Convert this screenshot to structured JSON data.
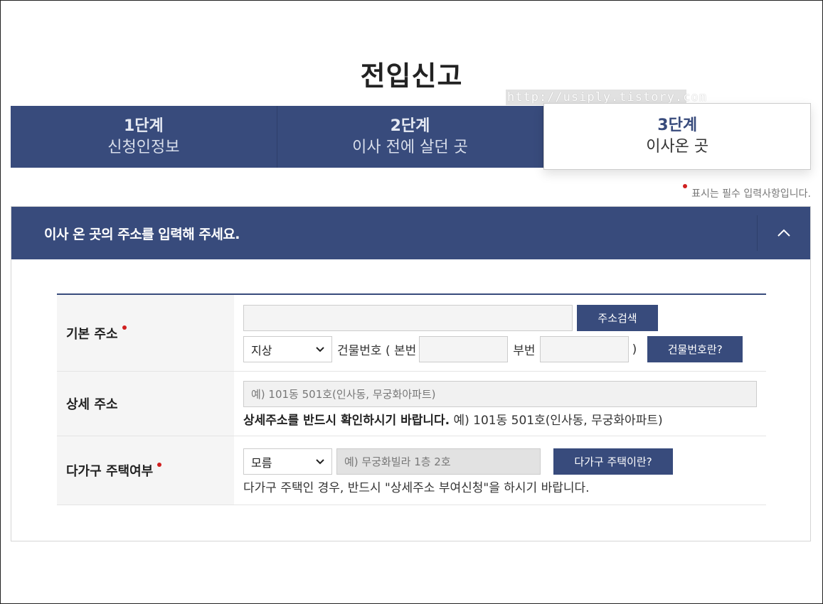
{
  "page": {
    "title": "전입신고",
    "watermark": "http://usiply.tistory.com"
  },
  "steps": [
    {
      "num": "1단계",
      "label": "신청인정보",
      "active": false
    },
    {
      "num": "2단계",
      "label": "이사 전에 살던 곳",
      "active": false
    },
    {
      "num": "3단계",
      "label": "이사온 곳",
      "active": true
    }
  ],
  "required_note": "표시는 필수 입력사항입니다.",
  "section": {
    "title": "이사 온 곳의 주소를 입력해 주세요.",
    "toggle_icon": "chevron-up-icon"
  },
  "form": {
    "basic_address": {
      "label": "기본 주소",
      "required": true,
      "search_button": "주소검색",
      "land_type": "지상",
      "building_no_label": "건물번호 ( 본번",
      "sub_no_label": "부번",
      "close_paren": ")",
      "building_no_button": "건물번호란?"
    },
    "detail_address": {
      "label": "상세 주소",
      "placeholder": "예) 101동 501호(인사동, 무궁화아파트)",
      "help_bold": "상세주소를 반드시 확인하시기 바랍니다.",
      "help_rest": " 예) 101동 501호(인사동, 무궁화아파트)"
    },
    "multi_household": {
      "label": "다가구 주택여부",
      "required": true,
      "select_value": "모름",
      "placeholder": "예) 무궁화빌라 1층 2호",
      "button": "다가구 주택이란?",
      "help": "다가구 주택인 경우, 반드시 \"상세주소 부여신청\"을 하시기 바랍니다."
    }
  },
  "colors": {
    "primary": "#384b7c",
    "required_dot": "#d01f1f"
  }
}
